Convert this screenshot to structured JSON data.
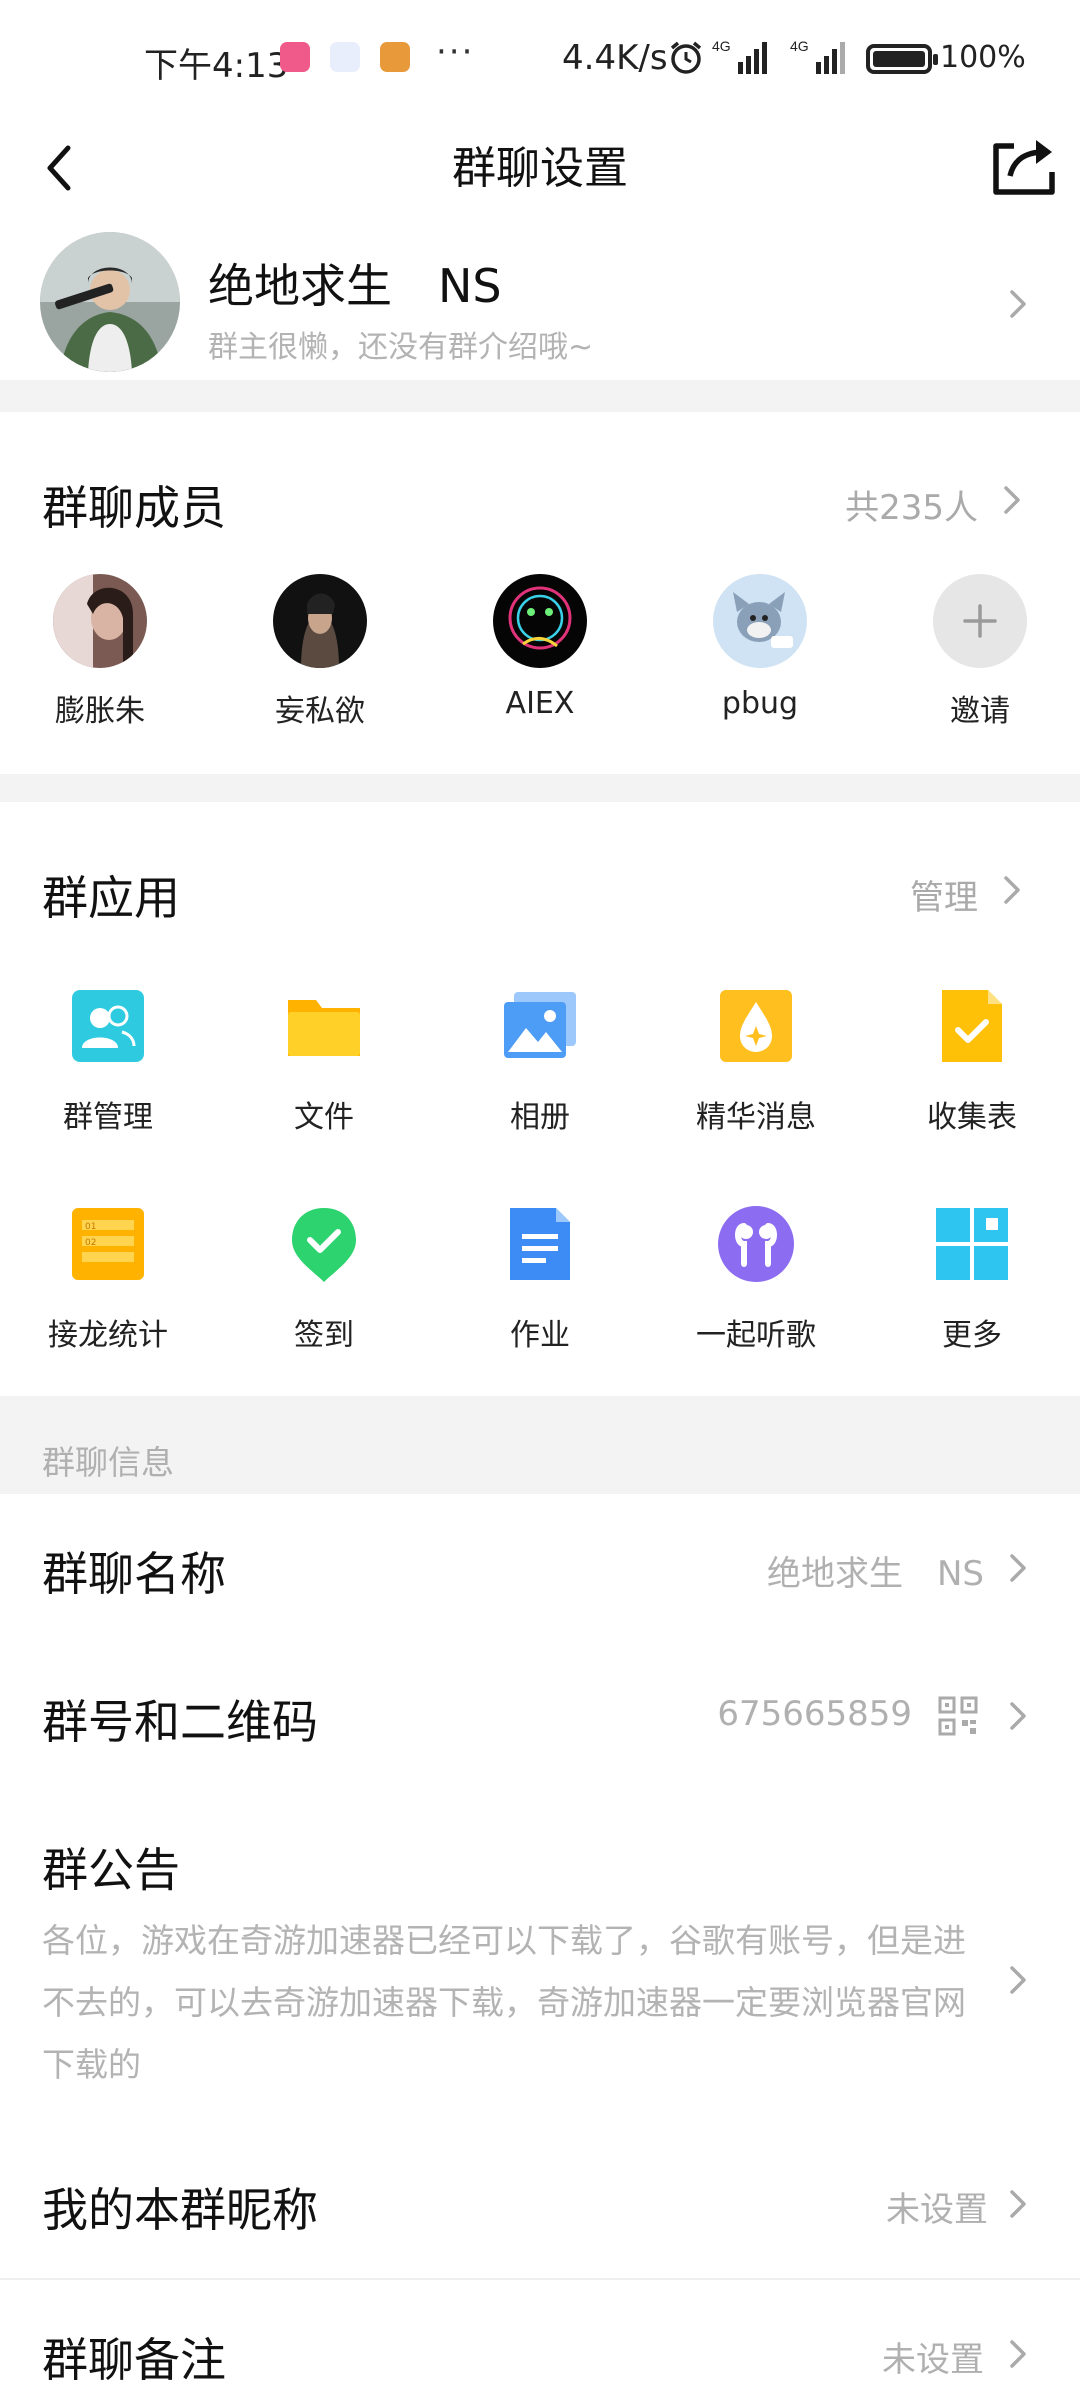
{
  "status_bar": {
    "time": "下午4:13",
    "dots": "···",
    "speed": "4.4K/s",
    "network_1": "4G",
    "network_2": "4G",
    "battery": "100%"
  },
  "nav": {
    "title": "群聊设置",
    "back_icon": "chevron-left-icon",
    "share_icon": "share-icon"
  },
  "group": {
    "name": "绝地求生　NS",
    "intro": "群主很懒，还没有群介绍哦~"
  },
  "members": {
    "title": "群聊成员",
    "count": "共235人",
    "list": [
      {
        "name": "膨胀朱"
      },
      {
        "name": "妄私欲"
      },
      {
        "name": "AIEX"
      },
      {
        "name": "pbug"
      }
    ],
    "invite_label": "邀请"
  },
  "apps": {
    "title": "群应用",
    "manage": "管理",
    "items": [
      {
        "label": "群管理",
        "icon": "group-manage-icon",
        "color": "#2ecbe0"
      },
      {
        "label": "文件",
        "icon": "folder-icon",
        "color": "#ffc107"
      },
      {
        "label": "相册",
        "icon": "album-icon",
        "color": "#4d9cf5"
      },
      {
        "label": "精华消息",
        "icon": "essence-drop-icon",
        "color": "#ffbf1f"
      },
      {
        "label": "收集表",
        "icon": "collect-form-icon",
        "color": "#ffc107"
      },
      {
        "label": "接龙统计",
        "icon": "solitaire-list-icon",
        "color": "#ffb300"
      },
      {
        "label": "签到",
        "icon": "checkin-location-icon",
        "color": "#2dd36f"
      },
      {
        "label": "作业",
        "icon": "homework-doc-icon",
        "color": "#3d8cf5"
      },
      {
        "label": "一起听歌",
        "icon": "earphones-icon",
        "color": "#8c6cf0"
      },
      {
        "label": "更多",
        "icon": "more-grid-icon",
        "color": "#2ec5f0"
      }
    ]
  },
  "info": {
    "section_label": "群聊信息",
    "group_name_label": "群聊名称",
    "group_name_value": "绝地求生　NS",
    "group_id_label": "群号和二维码",
    "group_id_value": "675665859",
    "notice_label": "群公告",
    "notice_text": "各位，游戏在奇游加速器已经可以下载了，谷歌有账号，但是进不去的，可以去奇游加速器下载，奇游加速器一定要浏览器官网下载的",
    "nickname_label": "我的本群昵称",
    "nickname_value": "未设置",
    "remark_label": "群聊备注",
    "remark_value": "未设置"
  }
}
